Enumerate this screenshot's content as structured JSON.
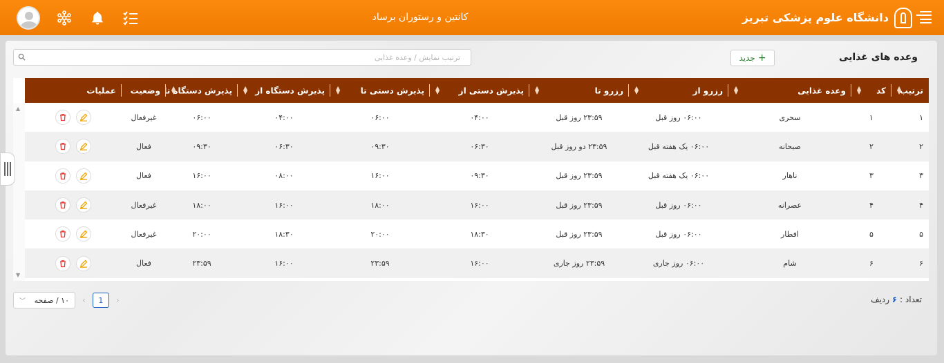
{
  "header": {
    "brand": "دانشگاه علوم پزشکی تبریز",
    "app_title": "کانتین و رستوران برساد"
  },
  "page": {
    "title": "وعده های غذایی",
    "new_label": "جدید",
    "search_placeholder": "ترتیب نمایش / وعده غذایی"
  },
  "table": {
    "columns": [
      "ترتیب",
      "کد",
      "وعده غذایی",
      "رزرو از",
      "رزرو تا",
      "پذیرش دستی از",
      "پذیرش دستی تا",
      "پذیرش دستگاه از",
      "پذیرش دستگاه تا",
      "وضعیت",
      "عملیات"
    ],
    "rows": [
      {
        "order": "۱",
        "code": "۱",
        "meal": "سحری",
        "res_from": "۰۶:۰۰ روز قبل",
        "res_to": "۲۳:۵۹ روز قبل",
        "man_from": "۰۴:۰۰",
        "man_to": "۰۶:۰۰",
        "dev_from": "۰۴:۰۰",
        "dev_to": "۰۶:۰۰",
        "status": "غیرفعال"
      },
      {
        "order": "۲",
        "code": "۲",
        "meal": "صبحانه",
        "res_from": "۰۶:۰۰ یک هفته قبل",
        "res_to": "۲۳:۵۹ دو روز قبل",
        "man_from": "۰۶:۳۰",
        "man_to": "۰۹:۳۰",
        "dev_from": "۰۶:۳۰",
        "dev_to": "۰۹:۳۰",
        "status": "فعال"
      },
      {
        "order": "۳",
        "code": "۳",
        "meal": "ناهار",
        "res_from": "۰۶:۰۰ یک هفته قبل",
        "res_to": "۲۳:۵۹ روز قبل",
        "man_from": "۰۹:۳۰",
        "man_to": "۱۶:۰۰",
        "dev_from": "۰۸:۰۰",
        "dev_to": "۱۶:۰۰",
        "status": "فعال"
      },
      {
        "order": "۴",
        "code": "۴",
        "meal": "عصرانه",
        "res_from": "۰۶:۰۰ روز قبل",
        "res_to": "۲۳:۵۹ روز قبل",
        "man_from": "۱۶:۰۰",
        "man_to": "۱۸:۰۰",
        "dev_from": "۱۶:۰۰",
        "dev_to": "۱۸:۰۰",
        "status": "غیرفعال"
      },
      {
        "order": "۵",
        "code": "۵",
        "meal": "افطار",
        "res_from": "۰۶:۰۰ روز قبل",
        "res_to": "۲۳:۵۹ روز قبل",
        "man_from": "۱۸:۳۰",
        "man_to": "۲۰:۰۰",
        "dev_from": "۱۸:۳۰",
        "dev_to": "۲۰:۰۰",
        "status": "غیرفعال"
      },
      {
        "order": "۶",
        "code": "۶",
        "meal": "شام",
        "res_from": "۰۶:۰۰ روز جاری",
        "res_to": "۲۳:۵۹ روز جاری",
        "man_from": "۱۶:۰۰",
        "man_to": "۲۳:۵۹",
        "dev_from": "۱۶:۰۰",
        "dev_to": "۲۳:۵۹",
        "status": "فعال"
      }
    ]
  },
  "footer": {
    "count_label": "تعداد :",
    "count_value": "۶",
    "count_unit": "ردیف",
    "page_size": "۱۰ / صفحه",
    "current_page": "1"
  },
  "colors": {
    "header": "#f07b00",
    "table_header": "#8a3300",
    "edit": "#f0a500",
    "delete": "#e53935",
    "accent": "#1f5fbf"
  },
  "icons": [
    "menu-icon",
    "university-logo-icon",
    "avatar-icon",
    "molecule-icon",
    "bell-icon",
    "checklist-icon",
    "plus-icon",
    "search-icon",
    "sort-icon",
    "edit-icon",
    "delete-icon",
    "chevron-down-icon"
  ]
}
